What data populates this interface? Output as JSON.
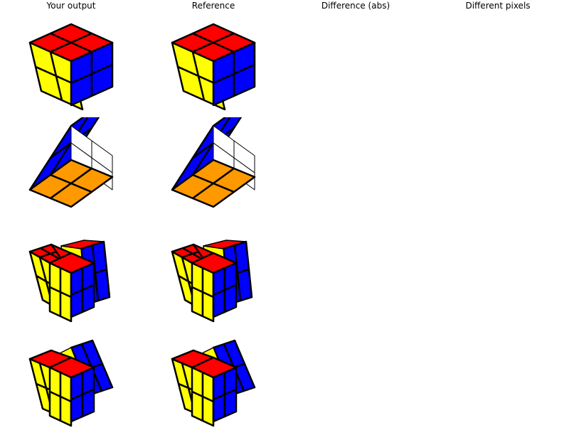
{
  "columns": [
    {
      "title": "Your output"
    },
    {
      "title": "Reference"
    },
    {
      "title": "Difference (abs)"
    },
    {
      "title": "Different pixels"
    }
  ],
  "colors": {
    "red": "#ff0000",
    "yellow": "#ffff00",
    "blue": "#0000ff",
    "white": "#ffffff",
    "orange": "#ff9900",
    "outline": "#000000",
    "background": "#ffffff"
  },
  "rows": [
    {
      "state": "solved-top-view",
      "faces_visible": [
        "red",
        "yellow",
        "blue"
      ]
    },
    {
      "state": "solved-bottom-view",
      "faces_visible": [
        "blue",
        "white",
        "orange"
      ]
    },
    {
      "state": "back-layer-turn-small",
      "faces_visible": [
        "red",
        "yellow",
        "blue"
      ]
    },
    {
      "state": "back-layer-turn-large",
      "faces_visible": [
        "red",
        "yellow",
        "blue"
      ]
    }
  ]
}
